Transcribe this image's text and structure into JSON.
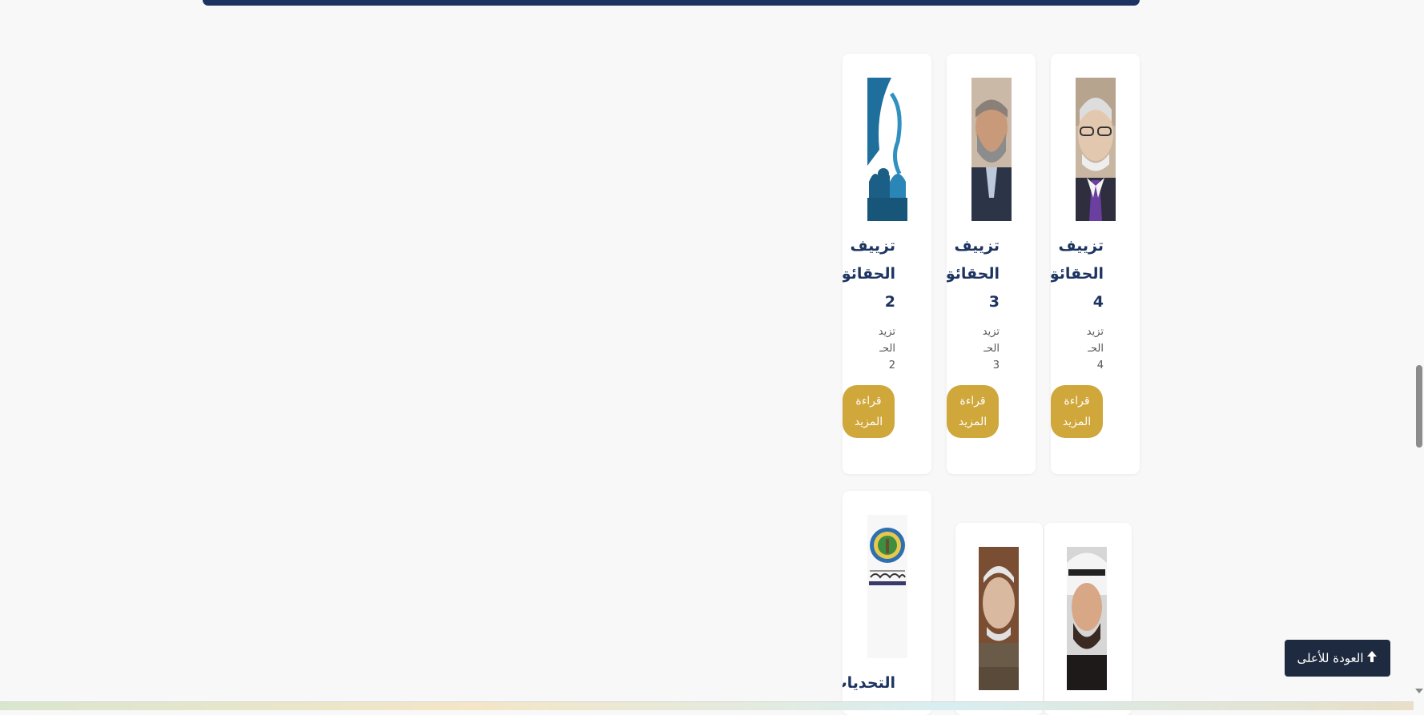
{
  "header": {
    "bar_color": "#1d3461"
  },
  "cards_row1": [
    {
      "title_line1": "تزييف",
      "title_line2": "الحقائق",
      "number": "4",
      "excerpt_line1": "تزيد",
      "excerpt_line2": "الحـ",
      "excerpt_num": "4",
      "button": "قراءة المزيد",
      "image": "elderly-man-portrait"
    },
    {
      "title_line1": "تزييف",
      "title_line2": "الحقائق",
      "number": "3",
      "excerpt_line1": "تزيد",
      "excerpt_line2": "الحـ",
      "excerpt_num": "3",
      "button": "قراءة المزيد",
      "image": "bearded-man-portrait"
    },
    {
      "title_line1": "تزييف",
      "title_line2": "الحقائق",
      "number": "2",
      "excerpt_line1": "تزيد",
      "excerpt_line2": "الحـ",
      "excerpt_num": "2",
      "button": "قراءة المزيد",
      "image": "calligraphy-mosque-art"
    }
  ],
  "cards_row2": [
    {
      "image": "man-ghutra-portrait"
    },
    {
      "image": "elderly-man-portrait-2"
    },
    {
      "image": "islamic-party-logo",
      "title_line1": "التحديات"
    }
  ],
  "back_to_top": {
    "label": "العودة للأعلى",
    "icon": "arrow-up-icon"
  },
  "colors": {
    "accent": "#cfa73a",
    "primary": "#1d3461",
    "background": "#f8f8f8"
  }
}
